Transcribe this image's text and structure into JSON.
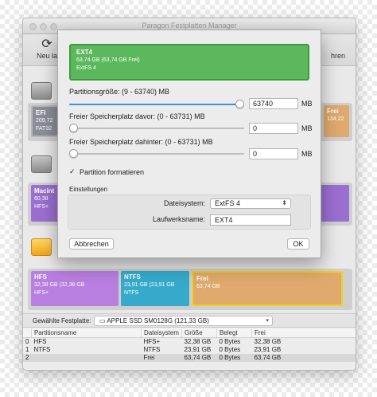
{
  "window": {
    "title": "Paragon Festplatten Manager"
  },
  "toolbar": {
    "left_label": "Neu la",
    "right_label": "hren"
  },
  "disks": {
    "disk1": {
      "efi": {
        "name": "EFI",
        "size": "209,72",
        "fs": "FAT32"
      },
      "frei": {
        "name": "Frei",
        "size": "134,22"
      }
    },
    "disk2": {
      "mac": {
        "name": "Macint",
        "size": "60,38",
        "fs": "HFS+"
      }
    },
    "disk3": {
      "hfs": {
        "name": "HFS",
        "size": "32,38 GB (32,38 GB",
        "fs": "HFS+"
      },
      "ntfs": {
        "name": "NTFS",
        "size": "23,91 GB (23,91 GB",
        "fs": "NTFS"
      },
      "frei": {
        "name": "Frei",
        "size": "63,74 GB"
      }
    }
  },
  "drive_bar": {
    "label": "Gewählte Festplatte:",
    "selected": "APPLE SSD SM0128G (121,33 GB)"
  },
  "partition_table": {
    "headers": [
      "",
      "Partitionsname",
      "Dateisystem",
      "Größe",
      "Belegt",
      "Frei"
    ],
    "rows": [
      [
        "0",
        "HFS",
        "HFS+",
        "32,38 GB",
        "0 Bytes",
        "32,38 GB"
      ],
      [
        "1",
        "NTFS",
        "NTFS",
        "23,91 GB",
        "0 Bytes",
        "23,91 GB"
      ],
      [
        "2",
        "",
        "Frei",
        "63,74 GB",
        "0 Bytes",
        "63,74 GB"
      ]
    ]
  },
  "dialog": {
    "partition": {
      "name": "EXT4",
      "size": "63,74 GB (63,74 GB Frei)",
      "fs": "ExtFS 4"
    },
    "size": {
      "label": "Partitionsgröße: (9 - 63740) MB",
      "value": "63740",
      "unit": "MB",
      "level": 1.0
    },
    "before": {
      "label": "Freier Speicherplatz davor: (0 - 63731) MB",
      "value": "0",
      "unit": "MB",
      "level": 0.0
    },
    "after": {
      "label": "Freier Speicherplatz dahinter: (0 - 63731) MB",
      "value": "0",
      "unit": "MB",
      "level": 0.0
    },
    "format_checkbox": {
      "label": "Partition formatieren",
      "checked": true
    },
    "settings": {
      "title": "Einstellungen",
      "filesystem_label": "Dateisystem:",
      "filesystem_value": "ExtFS 4",
      "volume_label": "Laufwerksname:",
      "volume_value": "EXT4"
    },
    "cancel_label": "Abbrechen",
    "ok_label": "OK"
  },
  "colors": {
    "ext4": "#5cb85c",
    "efi": "#8a8f97",
    "frei": "#e0a96d",
    "mac": "#9b6fd1",
    "hfs": "#b87ee0",
    "ntfs": "#35aacb",
    "slider": "#3b8fe6"
  }
}
